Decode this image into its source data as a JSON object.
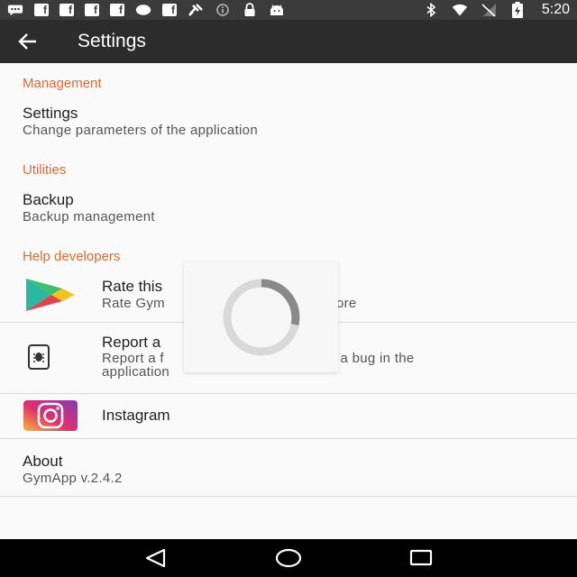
{
  "status_bar": {
    "left_icons": [
      "chat-icon",
      "facebook-icon",
      "facebook-icon",
      "facebook-icon",
      "facebook-icon",
      "circle-icon",
      "facebook-icon",
      "satellite-icon",
      "info-icon",
      "lock-icon",
      "android-icon"
    ],
    "fb_letter": "f",
    "right_icons": [
      "bluetooth-icon",
      "wifi-icon",
      "no-signal-icon",
      "battery-charging-icon"
    ],
    "time": "5:20"
  },
  "app_bar": {
    "title": "Settings",
    "background": "#2c2c2c"
  },
  "sections": {
    "management": {
      "header": "Management",
      "settings_title": "Settings",
      "settings_summary": "Change parameters of the application"
    },
    "utilities": {
      "header": "Utilities",
      "backup_title": "Backup",
      "backup_summary": "Backup management"
    },
    "help": {
      "header": "Help developers",
      "rate_title": "Rate this",
      "rate_summary_start": "Rate Gym",
      "rate_summary_end": "ore",
      "report_title": "Report a",
      "report_summary_start": "Report a f",
      "report_summary_end": "e or a bug in the",
      "report_summary_line2": "application",
      "instagram_title": "Instagram"
    },
    "about": {
      "title": "About",
      "summary": "GymApp v.2.4.2"
    }
  },
  "accent_color": "#e06a33",
  "loading_indicator": "loading-spinner",
  "nav_bar": {
    "buttons": [
      "back-triangle-icon",
      "home-circle-icon",
      "recents-square-icon"
    ]
  }
}
